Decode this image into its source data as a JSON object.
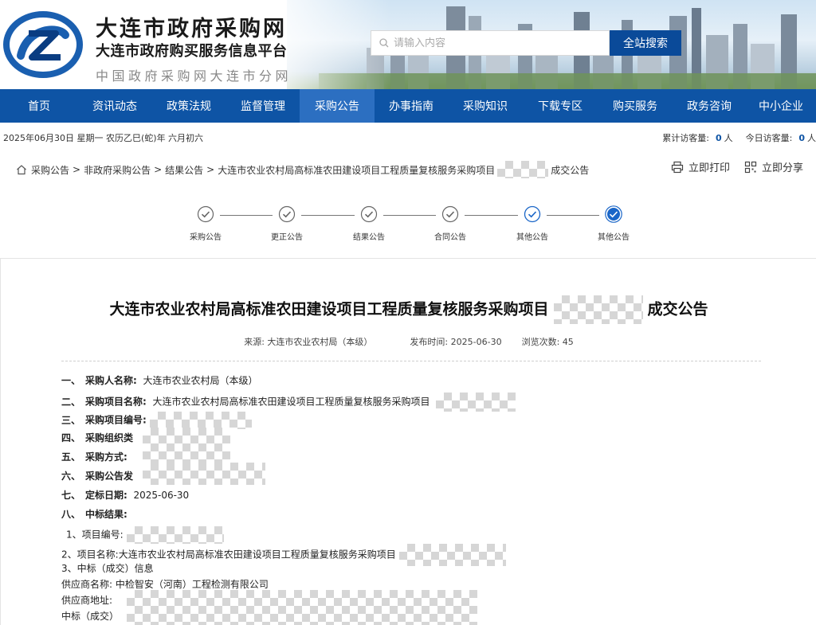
{
  "header": {
    "title": "大连市政府采购网",
    "subtitle": "大连市政府购买服务信息平台",
    "subtitle2": "中国政府采购网大连市分网",
    "search_placeholder": "请输入内容",
    "search_button": "全站搜索"
  },
  "nav": [
    {
      "label": "首页"
    },
    {
      "label": "资讯动态"
    },
    {
      "label": "政策法规"
    },
    {
      "label": "监督管理"
    },
    {
      "label": "采购公告",
      "active": true
    },
    {
      "label": "办事指南"
    },
    {
      "label": "采购知识"
    },
    {
      "label": "下载专区"
    },
    {
      "label": "购买服务"
    },
    {
      "label": "政务咨询"
    },
    {
      "label": "中小企业"
    }
  ],
  "datebar": {
    "date": "2025年06月30日 星期一 农历乙巳(蛇)年 六月初六",
    "total_label": "累计访客量:",
    "total_value": "0",
    "total_unit": "人",
    "today_label": "今日访客量:",
    "today_value": "0",
    "today_unit": "人"
  },
  "breadcrumb": {
    "items": [
      "采购公告",
      "非政府采购公告",
      "结果公告"
    ],
    "current_prefix": "大连市农业农村局高标准农田建设项目工程质量复核服务采购项目",
    "current_suffix": "成交公告",
    "sep": ">"
  },
  "actions": {
    "print": "立即打印",
    "share": "立即分享"
  },
  "steps": [
    {
      "label": "采购公告",
      "state": "done"
    },
    {
      "label": "更正公告",
      "state": "done"
    },
    {
      "label": "结果公告",
      "state": "done"
    },
    {
      "label": "合同公告",
      "state": "done"
    },
    {
      "label": "其他公告",
      "state": "blue"
    },
    {
      "label": "其他公告",
      "state": "current"
    }
  ],
  "article": {
    "title_prefix": "大连市农业农村局高标准农田建设项目工程质量复核服务采购项目",
    "title_suffix": "成交公告",
    "source_label": "来源:",
    "source_value": "大连市农业农村局（本级）",
    "publish_label": "发布时间:",
    "publish_value": "2025-06-30",
    "views_label": "浏览次数:",
    "views_value": "45",
    "sections": {
      "s1_num": "一、",
      "s1_label": "采购人名称:",
      "s1_value": "大连市农业农村局（本级）",
      "s2_num": "二、",
      "s2_label": "采购项目名称:",
      "s2_value": "大连市农业农村局高标准农田建设项目工程质量复核服务采购项目",
      "s3_num": "三、",
      "s3_label": "采购项目编号:",
      "s4_num": "四、",
      "s4_label": "采购组织类",
      "s5_num": "五、",
      "s5_label": "采购方式:",
      "s6_num": "六、",
      "s6_label": "采购公告发",
      "s7_num": "七、",
      "s7_label": "定标日期:",
      "s7_value": "2025-06-30",
      "s8_num": "八、",
      "s8_label": "中标结果:"
    },
    "result": {
      "item1": "1、项目编号:",
      "item2_label": "2、项目名称:",
      "item2_value": "大连市农业农村局高标准农田建设项目工程质量复核服务采购项目",
      "item3": "3、中标（成交）信息",
      "supplier_name_label": "供应商名称:",
      "supplier_name_value": "中检智安（河南）工程检测有限公司",
      "supplier_addr_label": "供应商地址:",
      "amount_label": "中标（成交）"
    }
  }
}
